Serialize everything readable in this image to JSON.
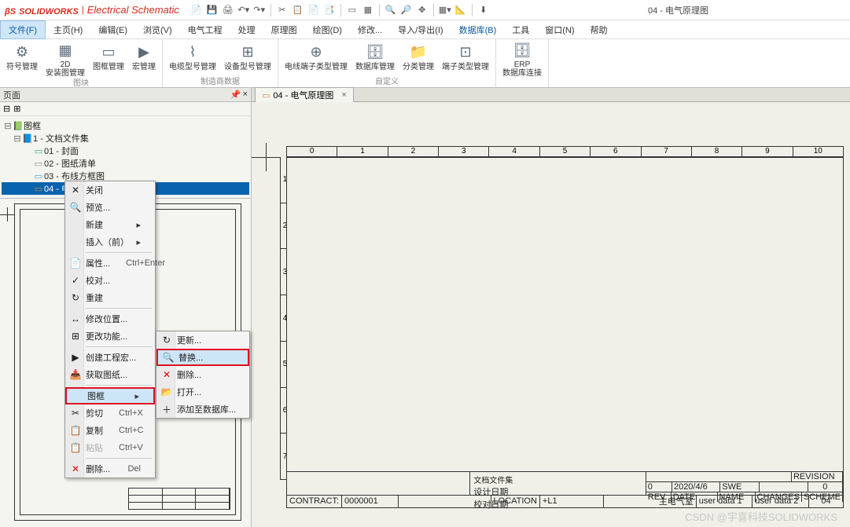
{
  "title": {
    "brand1": "SOLID",
    "brand2": "WORKS",
    "sep": "|",
    "suffix": "Electrical Schematic",
    "doc": "04 - 电气原理图"
  },
  "menu": [
    "文件(F)",
    "主页(H)",
    "编辑(E)",
    "浏览(V)",
    "电气工程",
    "处理",
    "原理图",
    "绘图(D)",
    "修改...",
    "导入/导出(I)",
    "数据库(B)",
    "工具",
    "窗口(N)",
    "帮助"
  ],
  "ribbon": {
    "g1": {
      "btns": [
        {
          "icon": "⚙",
          "label": "符号管理"
        },
        {
          "icon": "▦",
          "label": "2D\n安装图管理"
        },
        {
          "icon": "▭",
          "label": "图框管理"
        },
        {
          "icon": "▶",
          "label": "宏管理"
        }
      ],
      "label": "图块"
    },
    "g2": {
      "btns": [
        {
          "icon": "⌇",
          "label": "电缆型号管理"
        },
        {
          "icon": "⊞",
          "label": "设备型号管理"
        }
      ],
      "label": "制造商数据"
    },
    "g3": {
      "btns": [
        {
          "icon": "⊕",
          "label": "电线端子类型管理"
        },
        {
          "icon": "🗄",
          "label": "数据库管理"
        },
        {
          "icon": "📁",
          "label": "分类管理"
        },
        {
          "icon": "⊡",
          "label": "端子类型管理"
        }
      ],
      "label": "自定义"
    },
    "g4": {
      "btns": [
        {
          "icon": "🗄",
          "label": "ERP\n数据库连接"
        }
      ],
      "label": ""
    }
  },
  "leftPanel": {
    "title": "页面"
  },
  "tree": {
    "root": "图框",
    "n1": "1 - 文档文件集",
    "n2": "01 - 封面",
    "n3": "02 - 图纸清单",
    "n4": "03 - 布线方框图",
    "n5": "04 - 电气原理图"
  },
  "docTab": {
    "label": "04 - 电气原理图",
    "close": "×"
  },
  "rulerH": [
    "0",
    "1",
    "2",
    "3",
    "4",
    "5",
    "6",
    "7",
    "8",
    "9",
    "10"
  ],
  "rulerV": [
    "1",
    "2",
    "3",
    "4",
    "5",
    "6",
    "7"
  ],
  "titleblock": {
    "center1": "文档文件集",
    "center2": "设计日期",
    "center3": "校对日期",
    "rev": "REVISION",
    "revv": "0",
    "r2c1": "0",
    "r2c2": "2020/4/6",
    "r2c3": "SWE",
    "r3c1": "REV.",
    "r3c2": "DATE",
    "r3c3": "NAME",
    "r3c4": "CHANGES",
    "contract": "CONTRACT:",
    "contractv": "0000001",
    "location": "LOCATION",
    "locationv": "+L1",
    "main": "主电气室",
    "ud1": "user data 1",
    "ud2": "user data 2",
    "scheme": "SCHEME",
    "schemev": "04"
  },
  "ctx1": {
    "items": [
      {
        "icon": "✕",
        "label": "关闭"
      },
      {
        "icon": "🔍",
        "label": "预览..."
      },
      {
        "icon": "",
        "label": "新建",
        "arrow": true
      },
      {
        "icon": "",
        "label": "插入（前）",
        "arrow": true
      },
      {
        "sep": true
      },
      {
        "icon": "📄",
        "label": "属性...",
        "shortcut": "Ctrl+Enter"
      },
      {
        "icon": "✓",
        "label": "校对..."
      },
      {
        "icon": "↻",
        "label": "重建"
      },
      {
        "sep": true
      },
      {
        "icon": "↔",
        "label": "修改位置..."
      },
      {
        "icon": "⊞",
        "label": "更改功能..."
      },
      {
        "sep": true
      },
      {
        "icon": "▶",
        "label": "创建工程宏..."
      },
      {
        "icon": "📥",
        "label": "获取图纸..."
      },
      {
        "sep": true
      },
      {
        "icon": "",
        "label": "图框",
        "arrow": true,
        "hover": true,
        "red": true
      },
      {
        "icon": "✂",
        "label": "剪切",
        "shortcut": "Ctrl+X"
      },
      {
        "icon": "📋",
        "label": "复制",
        "shortcut": "Ctrl+C"
      },
      {
        "icon": "📋",
        "label": "粘贴",
        "shortcut": "Ctrl+V",
        "disabled": true
      },
      {
        "sep": true
      },
      {
        "icon": "✕",
        "label": "删除...",
        "shortcut": "Del",
        "iconColor": "#d00"
      }
    ]
  },
  "ctx2": {
    "items": [
      {
        "icon": "↻",
        "label": "更新..."
      },
      {
        "icon": "🔍",
        "label": "替换...",
        "hover": true,
        "red": true
      },
      {
        "icon": "✕",
        "label": "删除...",
        "iconColor": "#d00"
      },
      {
        "icon": "📂",
        "label": "打开..."
      },
      {
        "icon": "＋",
        "label": "添加至数据库..."
      }
    ]
  },
  "watermark": "CSDN @宇喜科技SOLIDWORKS"
}
